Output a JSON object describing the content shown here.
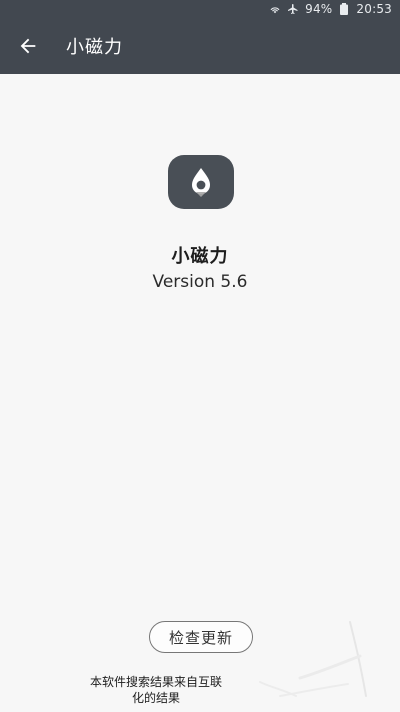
{
  "status_bar": {
    "battery_percent": "94%",
    "time": "20:53",
    "icons": [
      "wifi-icon",
      "airplane-icon",
      "battery-icon"
    ]
  },
  "app_bar": {
    "title": "小磁力",
    "back_icon": "arrow-left-icon"
  },
  "about": {
    "app_name": "小磁力",
    "version": "Version 5.6",
    "icon": "app-logo-icon"
  },
  "actions": {
    "check_update_label": "检查更新"
  },
  "disclaimer": {
    "line1": "本软件搜索结果来自互联",
    "line2": "化的结果"
  },
  "colors": {
    "app_bar_bg": "#424850",
    "background": "#f7f7f7",
    "icon_bg": "#494f56"
  }
}
